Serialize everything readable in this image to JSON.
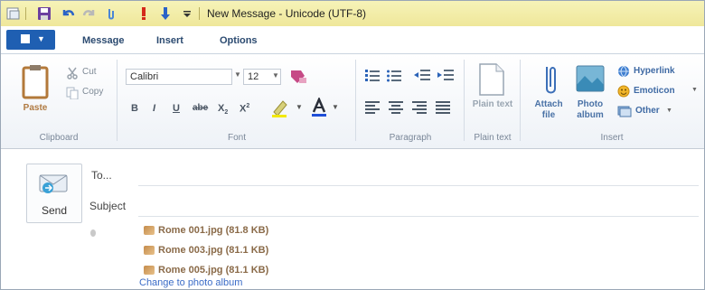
{
  "window": {
    "title": "New Message - Unicode (UTF-8)"
  },
  "tabs": [
    "Message",
    "Insert",
    "Options"
  ],
  "clipboard": {
    "group_label": "Clipboard",
    "paste": "Paste",
    "cut": "Cut",
    "copy": "Copy"
  },
  "font": {
    "group_label": "Font",
    "family": "Calibri",
    "size": "12"
  },
  "paragraph": {
    "group_label": "Paragraph"
  },
  "plain_text": {
    "group_label": "Plain text",
    "button": "Plain text"
  },
  "insert": {
    "group_label": "Insert",
    "attach_file": "Attach file",
    "photo_album": "Photo album",
    "hyperlink": "Hyperlink",
    "emoticon": "Emoticon",
    "other": "Other"
  },
  "message": {
    "send": "Send",
    "to_label": "To...",
    "subject_label": "Subject",
    "attachments": [
      "Rome 001.jpg (81.8 KB)",
      "Rome 003.jpg (81.1 KB)",
      "Rome 005.jpg (81.1 KB)"
    ],
    "change_album": "Change to photo album"
  },
  "colors": {
    "accent": "#1f5fb2",
    "title_bar": "#f1eaa3",
    "link": "#3b6cc7"
  }
}
